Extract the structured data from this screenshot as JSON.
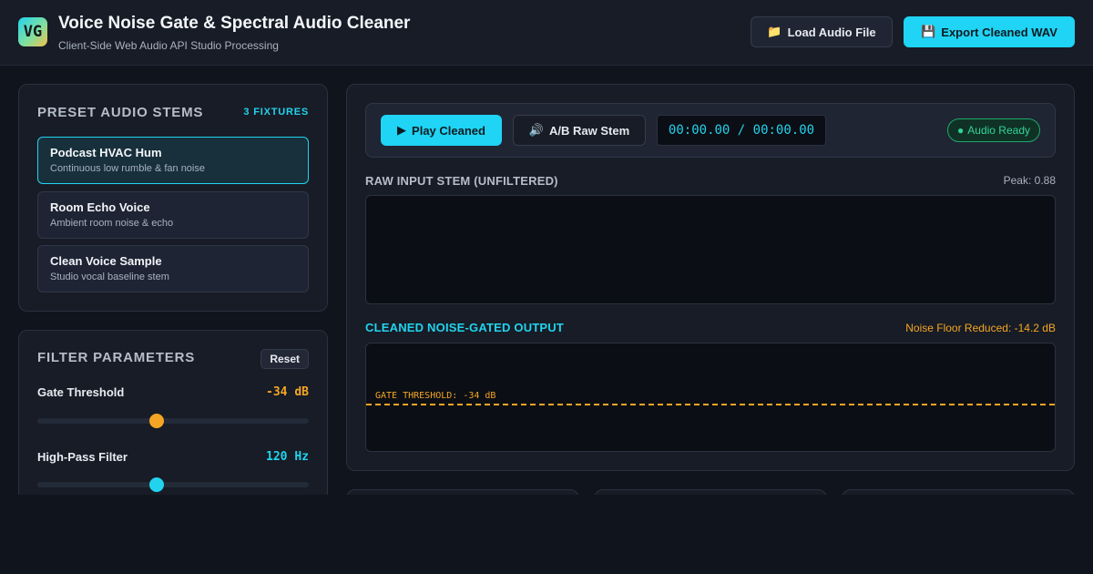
{
  "app": {
    "logo_text": "VG",
    "title": "Voice Noise Gate & Spectral Audio Cleaner",
    "subtitle": "Client-Side Web Audio API Studio Processing"
  },
  "header": {
    "load_icon": "folder-icon",
    "load_label": "Load Audio File",
    "export_icon": "save-icon",
    "export_label": "Export Cleaned WAV"
  },
  "presets": {
    "title": "PRESET AUDIO STEMS",
    "badge": "3 FIXTURES",
    "items": [
      {
        "name": "Podcast HVAC Hum",
        "description": "Continuous low rumble & fan noise",
        "active": true
      },
      {
        "name": "Room Echo Voice",
        "description": "Ambient room noise & echo",
        "active": false
      },
      {
        "name": "Clean Voice Sample",
        "description": "Studio vocal baseline stem",
        "active": false
      }
    ]
  },
  "filters": {
    "title": "FILTER PARAMETERS",
    "reset_label": "Reset",
    "params": [
      {
        "label": "Gate Threshold",
        "value": "-34 dB",
        "level": 0.44,
        "color": "#f5a524"
      },
      {
        "label": "High-Pass Filter",
        "value": "120 Hz",
        "level": 0.44,
        "color": "#22d3ee"
      }
    ]
  },
  "transport": {
    "play_icon": "play-icon",
    "play_label": "Play Cleaned",
    "ab_icon": "speaker-icon",
    "ab_label": "A/B Raw Stem",
    "timecode": "00:00.00 / 00:00.00",
    "status": "Audio Ready"
  },
  "raw_wave": {
    "title": "RAW INPUT STEM (UNFILTERED)",
    "meta": "Peak: 0.88"
  },
  "clean_wave": {
    "title": "CLEANED NOISE-GATED OUTPUT",
    "meta": "Noise Floor Reduced: -14.2 dB",
    "gate_label": "GATE THRESHOLD: -34 dB"
  },
  "colors": {
    "accent": "#22d3ee",
    "warning": "#f5a524",
    "success": "#34d399"
  }
}
